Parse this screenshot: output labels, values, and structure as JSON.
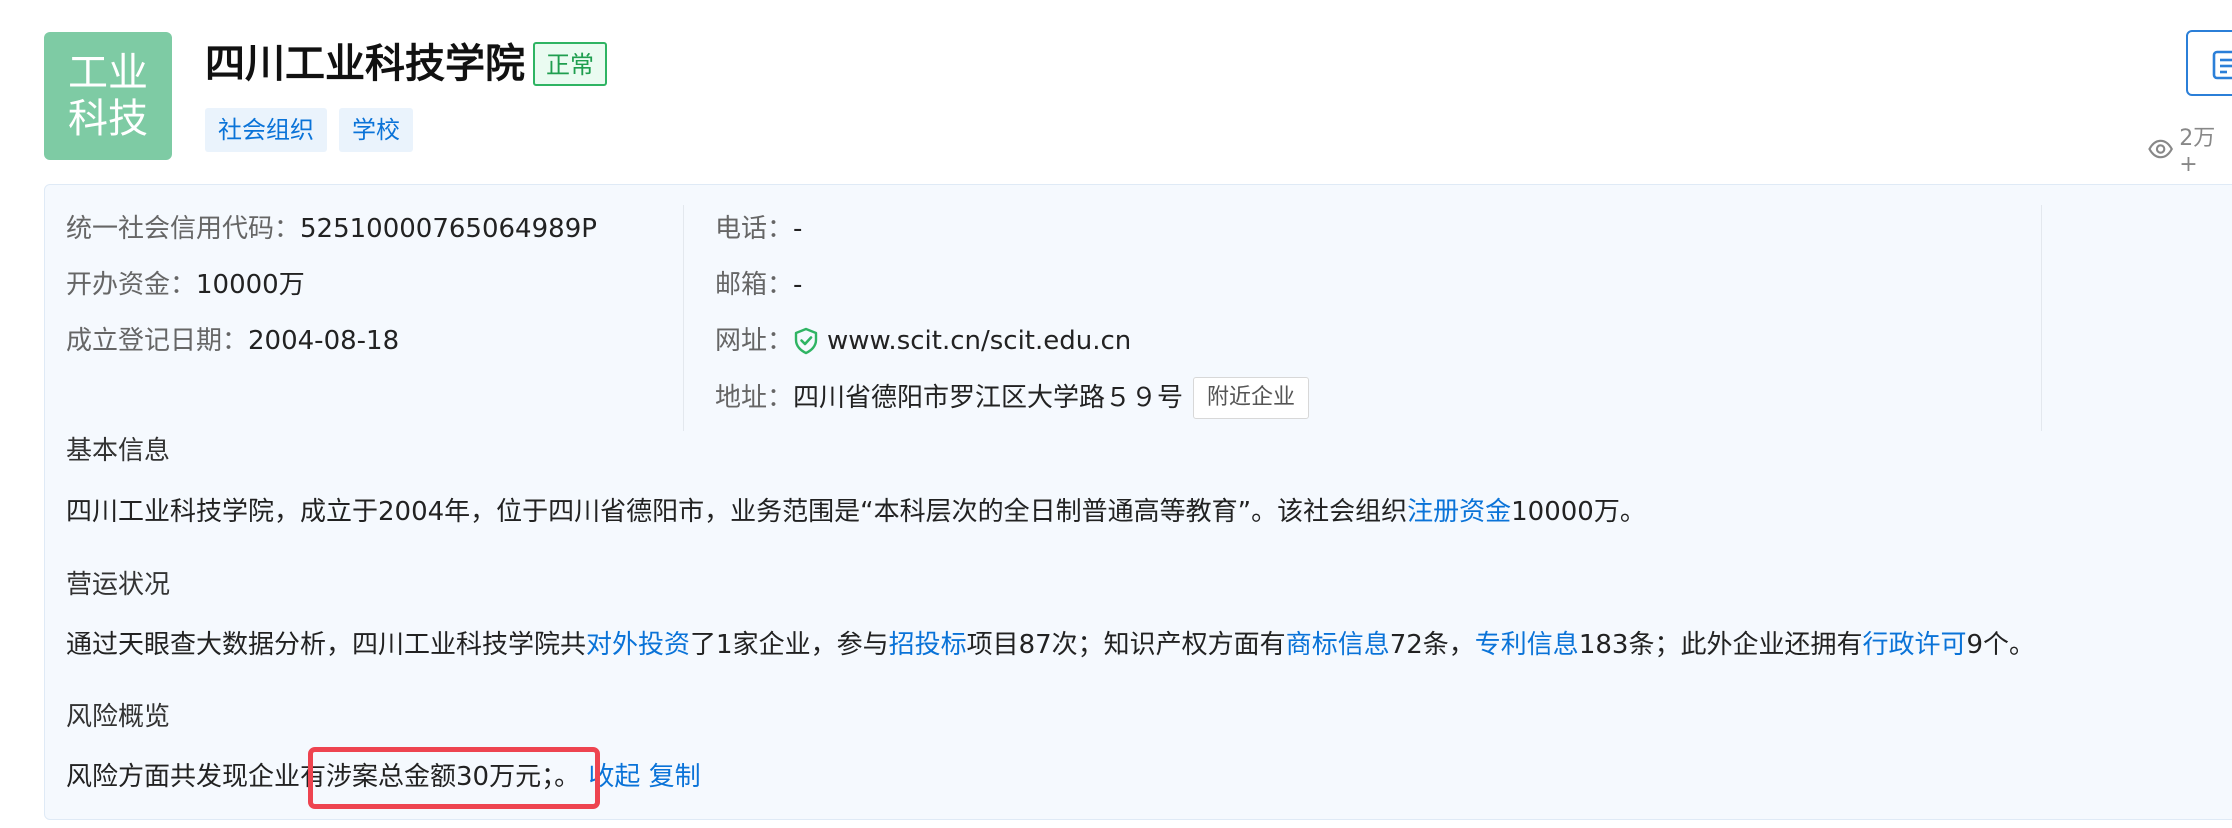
{
  "header": {
    "logo_line1": "工业",
    "logo_line2": "科技",
    "company_name": "四川工业科技学院",
    "status": "正常",
    "tags": [
      "社会组织",
      "学校"
    ],
    "views": "2万+"
  },
  "info": {
    "credit_code_label": "统一社会信用代码：",
    "credit_code": "52510000765064989P",
    "capital_label": "开办资金：",
    "capital": "10000万",
    "date_label": "成立登记日期：",
    "date": "2004-08-18",
    "phone_label": "电话：",
    "phone": "-",
    "email_label": "邮箱：",
    "email": "-",
    "website_label": "网址：",
    "website": "www.scit.cn/scit.edu.cn",
    "address_label": "地址：",
    "address": "四川省德阳市罗江区大学路５９号",
    "nearby_button": "附近企业"
  },
  "basic": {
    "title": "基本信息",
    "text1": "四川工业科技学院，成立于2004年，位于四川省德阳市，业务范围是“本科层次的全日制普通高等教育”。该社会组织",
    "link1": "注册资金",
    "text2": "10000万。"
  },
  "operation": {
    "title": "营运状况",
    "t1": "通过天眼查大数据分析，四川工业科技学院共",
    "l1": "对外投资",
    "t2": "了1家企业，参与",
    "l2": "招投标",
    "t3": "项目87次；知识产权方面有",
    "l3": "商标信息",
    "t4": "72条，",
    "l4": "专利信息",
    "t5": "183条；此外企业还拥有",
    "l5": "行政许可",
    "t6": "9个。"
  },
  "risk": {
    "title": "风险概览",
    "t1": "风险方面共发现企业",
    "t2": "有涉案总金额30万元；",
    "t3": "。",
    "collapse": "收起",
    "copy": "复制"
  },
  "colors": {
    "brand_blue": "#0a73d8",
    "status_green": "#1f9e4f",
    "logo_bg": "#7ecba4",
    "highlight_red": "#ee4450"
  },
  "icons": [
    "eye-icon",
    "shield-check-icon",
    "document-icon"
  ]
}
